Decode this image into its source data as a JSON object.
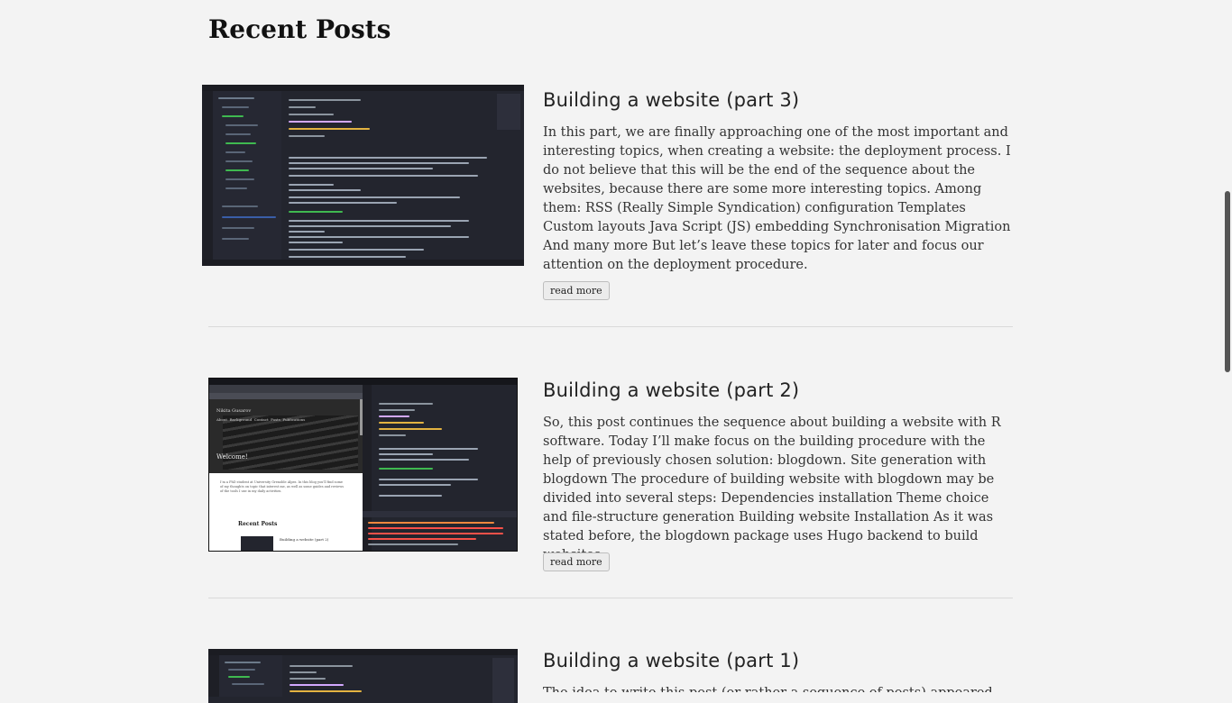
{
  "section": {
    "title": "Recent Posts"
  },
  "posts": [
    {
      "title": "Building a website (part 3)",
      "excerpt": "In this part, we are finally approaching one of the most important and interesting topics, when creating a website: the deployment process. I do not believe that this will be the end of the sequence about the websites, because there are some more interesting topics. Among them: RSS (Really Simple Syndication) configuration Templates Custom layouts Java Script (JS) embedding Synchronisation Migration And many more But let’s leave these topics for later and focus our attention on the deployment procedure.",
      "read_more": "read more"
    },
    {
      "title": "Building a website (part 2)",
      "excerpt": "So, this post continues the sequence about building a website with R software. Today I’ll make focus on the building procedure with the help of previously chosen solution: blogdown. Site generation with blogdown The procedure of building website with blogdown may be divided into several steps: Dependencies installation Theme choice and file-structure generation Building website Installation As it was stated before, the blogdown package uses Hugo backend to build websites.",
      "read_more": "read more",
      "thumb": {
        "site_name": "Nikita Gusarov",
        "nav": [
          "About",
          "Background",
          "Contact",
          "Posts",
          "Publications"
        ],
        "welcome": "Welcome!",
        "intro": "I’m a PhD student at University Grenoble Alpes. In this blog you’ll find some of my thoughts on topic that interest me, as well as some guides and reviews of the tools I use in my daily activities.",
        "recent": "Recent Posts",
        "recent_item": "Building a website (part 2)"
      }
    },
    {
      "title": "Building a website (part 1)",
      "excerpt": "The idea to write this post (or rather a sequence of posts) appeared"
    }
  ]
}
